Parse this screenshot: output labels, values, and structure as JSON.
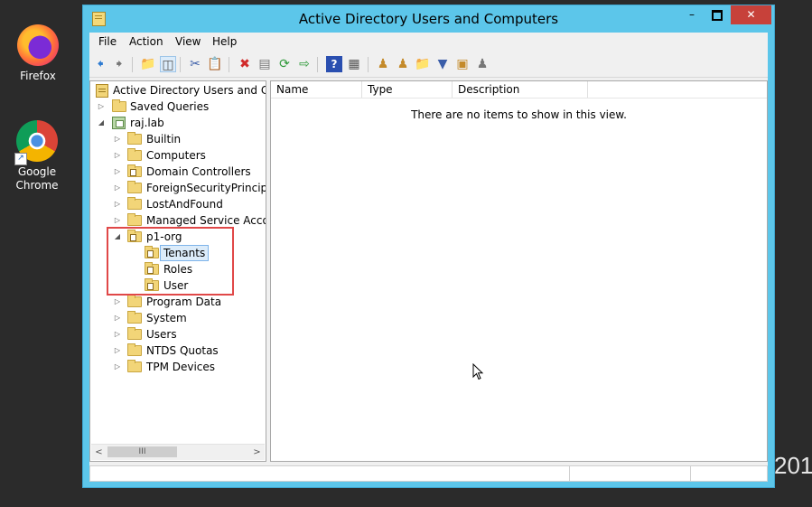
{
  "desktop": {
    "icons": [
      {
        "label": "Firefox",
        "icon": "firefox-icon"
      },
      {
        "label": "Google Chrome",
        "icon": "chrome-icon"
      }
    ],
    "background_text": "201"
  },
  "window": {
    "title": "Active Directory Users and Computers",
    "controls": {
      "minimize": "–",
      "maximize": "",
      "close": "✕"
    },
    "menu": [
      "File",
      "Action",
      "View",
      "Help"
    ],
    "toolbar_icons": [
      "back-icon",
      "forward-icon",
      "up-folder-icon",
      "show-hide-console-tree-icon",
      "cut-icon",
      "paste-icon",
      "delete-icon",
      "properties-icon",
      "refresh-icon",
      "export-list-icon",
      "help-icon",
      "show-action-pane-icon",
      "new-user-icon",
      "new-group-icon",
      "new-ou-icon",
      "filter-icon",
      "add-to-group-icon",
      "delegate-control-icon"
    ]
  },
  "tree": {
    "root": "Active Directory Users and Com",
    "saved_queries": "Saved Queries",
    "domain": "raj.lab",
    "containers": [
      {
        "label": "Builtin",
        "type": "folder",
        "expander": "▷"
      },
      {
        "label": "Computers",
        "type": "folder",
        "expander": "▷"
      },
      {
        "label": "Domain Controllers",
        "type": "ou",
        "expander": "▷"
      },
      {
        "label": "ForeignSecurityPrincipals",
        "type": "folder",
        "expander": "▷"
      },
      {
        "label": "LostAndFound",
        "type": "folder",
        "expander": "▷"
      },
      {
        "label": "Managed Service Accoun",
        "type": "folder",
        "expander": "▷"
      },
      {
        "label": "p1-org",
        "type": "ou",
        "expander": "◢"
      },
      {
        "label": "Program Data",
        "type": "folder",
        "expander": "▷"
      },
      {
        "label": "System",
        "type": "folder",
        "expander": "▷"
      },
      {
        "label": "Users",
        "type": "folder",
        "expander": "▷"
      },
      {
        "label": "NTDS Quotas",
        "type": "folder",
        "expander": "▷"
      },
      {
        "label": "TPM Devices",
        "type": "folder",
        "expander": "▷"
      }
    ],
    "p1_org_children": [
      {
        "label": "Tenants",
        "selected": true
      },
      {
        "label": "Roles",
        "selected": false
      },
      {
        "label": "User",
        "selected": false
      }
    ],
    "scrollbar": {
      "left": "<",
      "thumb": "III",
      "right": ">"
    }
  },
  "list": {
    "columns": [
      "Name",
      "Type",
      "Description"
    ],
    "empty_message": "There are no items to show in this view."
  },
  "colors": {
    "window_frame": "#5cc6ea",
    "close_button": "#c7413a",
    "highlight_box": "#e04848",
    "selection": "#dcecfa"
  }
}
